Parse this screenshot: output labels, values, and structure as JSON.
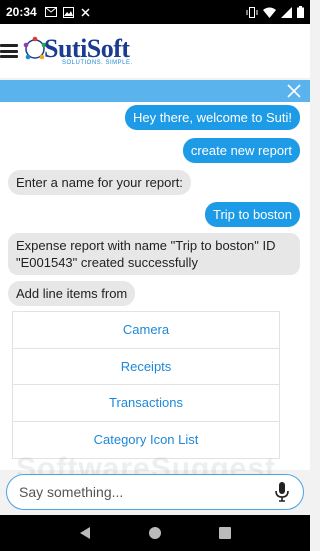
{
  "status_bar": {
    "time": "20:34"
  },
  "header": {
    "logo_name": "SutiSoft",
    "logo_tagline": "SOLUTIONS. SIMPLE."
  },
  "messages": [
    {
      "from": "user",
      "text": "Hey there, welcome to Suti!"
    },
    {
      "from": "user",
      "text": "create new report"
    },
    {
      "from": "bot",
      "text": "Enter a name for your report:"
    },
    {
      "from": "user",
      "text": "Trip to boston"
    },
    {
      "from": "bot",
      "text": "Expense report with name \"Trip to boston\" ID \"E001543\" created successfully"
    },
    {
      "from": "bot",
      "text": "Add line items from"
    }
  ],
  "options": [
    "Camera",
    "Receipts",
    "Transactions",
    "Category Icon List"
  ],
  "watermark": "SoftwareSuggest",
  "input": {
    "placeholder": "Say something..."
  },
  "colors": {
    "accent": "#1e9be6",
    "bar": "#5ab3ec",
    "link": "#1e88d8"
  }
}
